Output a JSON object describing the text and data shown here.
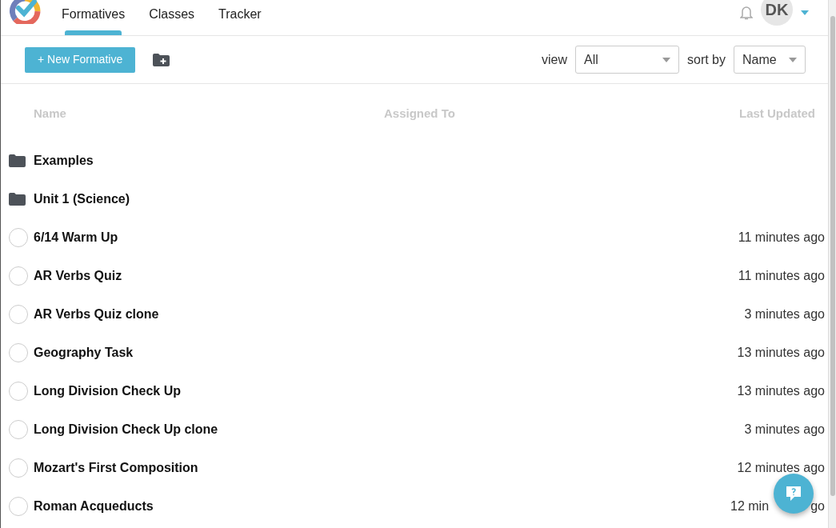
{
  "nav": {
    "tabs": [
      {
        "label": "Formatives",
        "selected": true
      },
      {
        "label": "Classes",
        "selected": false
      },
      {
        "label": "Tracker",
        "selected": false
      }
    ],
    "avatar": "DK"
  },
  "toolbar": {
    "new_button": "+ New Formative",
    "view_label": "view",
    "view_value": "All",
    "sort_label": "sort by",
    "sort_value": "Name"
  },
  "table": {
    "columns": [
      "Name",
      "Assigned To",
      "Last Updated"
    ],
    "rows": [
      {
        "kind": "folder",
        "name": "Examples"
      },
      {
        "kind": "folder",
        "name": "Unit 1 (Science)"
      },
      {
        "kind": "formative",
        "name": "6/14 Warm Up",
        "checked": false,
        "updated": "11 minutes ago"
      },
      {
        "kind": "formative",
        "name": "AR Verbs Quiz",
        "checked": false,
        "updated": "11 minutes ago"
      },
      {
        "kind": "formative",
        "name": "AR Verbs Quiz clone",
        "checked": false,
        "updated": "3 minutes ago"
      },
      {
        "kind": "formative",
        "name": "Geography Task",
        "checked": false,
        "updated": "13 minutes ago"
      },
      {
        "kind": "formative",
        "name": "Long Division Check Up",
        "checked": false,
        "updated": "13 minutes ago"
      },
      {
        "kind": "formative",
        "name": "Long Division Check Up clone",
        "checked": false,
        "updated": "3 minutes ago"
      },
      {
        "kind": "formative",
        "name": "Mozart's First Composition",
        "checked": false,
        "updated": "12 minutes ago"
      },
      {
        "kind": "formative",
        "name": "Roman Acqueducts",
        "checked": false,
        "updated": "12 min",
        "updated_tail": "go"
      }
    ]
  }
}
